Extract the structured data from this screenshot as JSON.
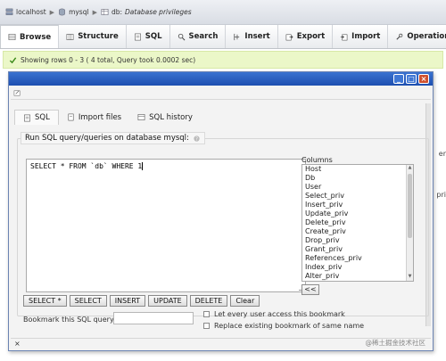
{
  "breadcrumb": {
    "server": "localhost",
    "database": "mysql",
    "table_prefix": "db:",
    "table": "Database privileges"
  },
  "tabs": [
    {
      "label": "Browse",
      "icon": "browse-icon",
      "active": true
    },
    {
      "label": "Structure",
      "icon": "structure-icon",
      "active": false
    },
    {
      "label": "SQL",
      "icon": "sql-icon",
      "active": false
    },
    {
      "label": "Search",
      "icon": "search-icon",
      "active": false
    },
    {
      "label": "Insert",
      "icon": "insert-icon",
      "active": false
    },
    {
      "label": "Export",
      "icon": "export-icon",
      "active": false
    },
    {
      "label": "Import",
      "icon": "import-icon",
      "active": false
    },
    {
      "label": "Operations",
      "icon": "operations-icon",
      "active": false
    }
  ],
  "success_message": "Showing rows 0 - 3 ( 4 total, Query took 0.0002 sec)",
  "background_edge": {
    "a": "er",
    "b": "pri"
  },
  "dialog": {
    "subtabs": [
      {
        "label": "SQL",
        "icon": "sql-icon",
        "active": true
      },
      {
        "label": "Import files",
        "icon": "import-files-icon",
        "active": false
      },
      {
        "label": "SQL history",
        "icon": "sql-history-icon",
        "active": false
      }
    ],
    "legend": "Run SQL query/queries on database mysql:",
    "query": "SELECT * FROM `db` WHERE 1",
    "columns_label": "Columns",
    "columns": [
      "Host",
      "Db",
      "User",
      "Select_priv",
      "Insert_priv",
      "Update_priv",
      "Delete_priv",
      "Create_priv",
      "Drop_priv",
      "Grant_priv",
      "References_priv",
      "Index_priv",
      "Alter_priv"
    ],
    "insert_column_button": "<<",
    "query_buttons": [
      "SELECT *",
      "SELECT",
      "INSERT",
      "UPDATE",
      "DELETE",
      "Clear"
    ],
    "bookmark_label": "Bookmark this SQL query:",
    "bookmark_value": "",
    "checkboxes": [
      {
        "label": "Let every user access this bookmark",
        "checked": false
      },
      {
        "label": "Replace existing bookmark of same name",
        "checked": false
      }
    ],
    "watermark": "@稀土掘金技术社区"
  },
  "colors": {
    "title_bar": "#2a5fc2",
    "success_bg": "#ebf7c8",
    "close_button": "#d0512e"
  }
}
